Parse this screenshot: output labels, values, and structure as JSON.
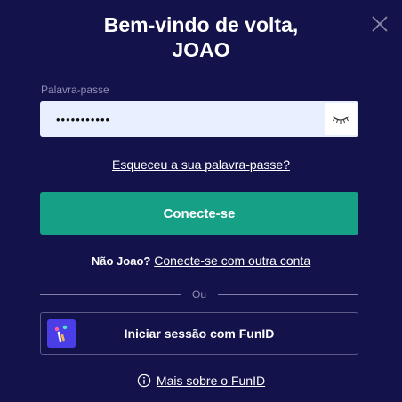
{
  "modal": {
    "title_line1": "Bem-vindo de volta,",
    "title_line2": "JOAO",
    "close_icon": "close-icon"
  },
  "password": {
    "label": "Palavra-passe",
    "value": "•••••••••••",
    "toggle_icon": "eye-closed-icon"
  },
  "forgot_link": "Esqueceu a sua palavra-passe?",
  "connect_button": "Conecte-se",
  "not_user": {
    "label": "Não Joao?",
    "link": "Conecte-se com outra conta"
  },
  "divider_text": "Ou",
  "funid_button": {
    "label": "Iniciar sessão com FunID",
    "logo_icon": "funid-logo"
  },
  "more_funid": {
    "icon": "info-icon",
    "link": "Mais sobre o FunID"
  },
  "colors": {
    "background": "#13124a",
    "primary_button": "#16a085",
    "input_background": "#e8efff",
    "funid_logo": "#4a3ee6"
  }
}
